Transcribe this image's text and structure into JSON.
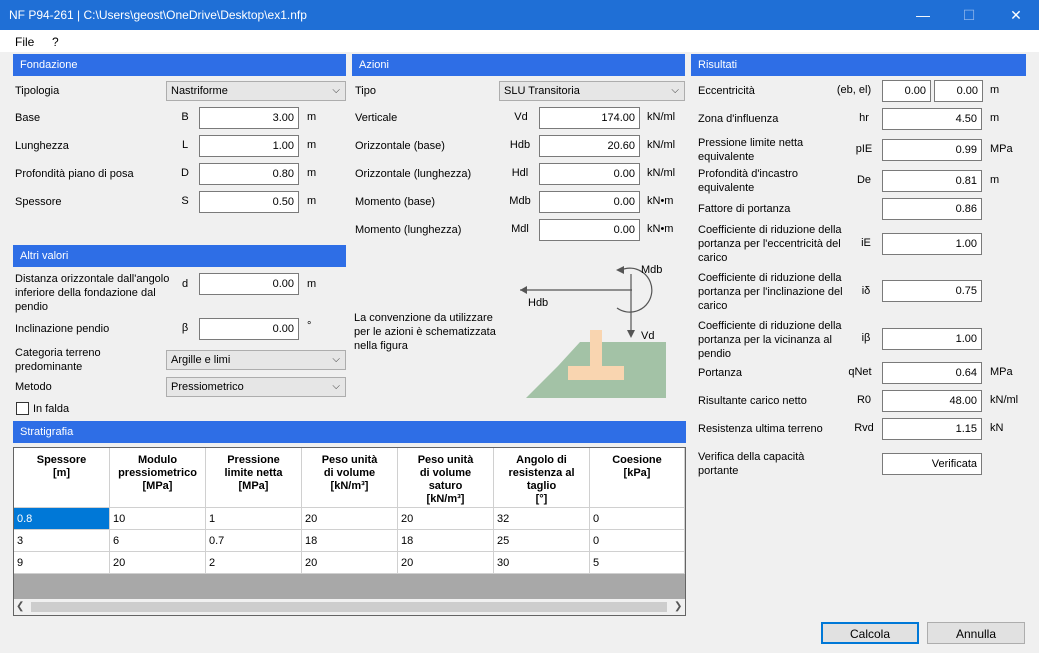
{
  "window": {
    "title": "NF P94-261 | C:\\Users\\geost\\OneDrive\\Desktop\\ex1.nfp",
    "min": "—",
    "max": "☐",
    "close": "✕"
  },
  "menu": [
    "File",
    "?"
  ],
  "fondazione": {
    "title": "Fondazione",
    "tipologia_label": "Tipologia",
    "tipologia_value": "Nastriforme",
    "rows": [
      {
        "label": "Base",
        "sym": "B",
        "value": "3.00",
        "unit": "m"
      },
      {
        "label": "Lunghezza",
        "sym": "L",
        "value": "1.00",
        "unit": "m"
      },
      {
        "label": "Profondità piano di posa",
        "sym": "D",
        "value": "0.80",
        "unit": "m"
      },
      {
        "label": "Spessore",
        "sym": "S",
        "value": "0.50",
        "unit": "m"
      }
    ]
  },
  "altri": {
    "title": "Altri valori",
    "distanza_label": "Distanza orizzontale dall'angolo inferiore della fondazione dal pendio",
    "distanza_sym": "d",
    "distanza_value": "0.00",
    "distanza_unit": "m",
    "incl_label": "Inclinazione pendio",
    "incl_sym": "β",
    "incl_value": "0.00",
    "incl_unit": "°",
    "cat_label": "Categoria terreno predominante",
    "cat_value": "Argille e limi",
    "metodo_label": "Metodo",
    "metodo_value": "Pressiometrico",
    "falda_label": "In falda"
  },
  "azioni": {
    "title": "Azioni",
    "tipo_label": "Tipo",
    "tipo_value": "SLU Transitoria",
    "rows": [
      {
        "label": "Verticale",
        "sym": "Vd",
        "value": "174.00",
        "unit": "kN/ml"
      },
      {
        "label": "Orizzontale (base)",
        "sym": "Hdb",
        "value": "20.60",
        "unit": "kN/ml"
      },
      {
        "label": "Orizzontale (lunghezza)",
        "sym": "Hdl",
        "value": "0.00",
        "unit": "kN/ml"
      },
      {
        "label": "Momento (base)",
        "sym": "Mdb",
        "value": "0.00",
        "unit": "kN•m"
      },
      {
        "label": "Momento (lunghezza)",
        "sym": "Mdl",
        "value": "0.00",
        "unit": "kN•m"
      }
    ],
    "note": "La convenzione da utilizzare per le azioni è schematizzata nella figura",
    "fig_mdb": "Mdb",
    "fig_hdb": "Hdb",
    "fig_vd": "Vd"
  },
  "risultati": {
    "title": "Risultati",
    "ecc_label": "Eccentricità",
    "ecc_sym": "(eb, el)",
    "ecc_v1": "0.00",
    "ecc_v2": "0.00",
    "ecc_unit": "m",
    "rows": [
      {
        "label": "Zona d'influenza",
        "sym": "hr",
        "value": "4.50",
        "unit": "m"
      },
      {
        "label": "Pressione limite netta equivalente",
        "sym": "pIE",
        "value": "0.99",
        "unit": "MPa"
      },
      {
        "label": "Profondità d'incastro equivalente",
        "sym": "De",
        "value": "0.81",
        "unit": "m"
      },
      {
        "label": "Fattore di portanza",
        "sym": "",
        "value": "0.86",
        "unit": ""
      },
      {
        "label": "Coefficiente di riduzione della portanza per l'eccentricità del carico",
        "sym": "iE",
        "value": "1.00",
        "unit": ""
      },
      {
        "label": "Coefficiente di riduzione della portanza per l'inclinazione del carico",
        "sym": "iδ",
        "value": "0.75",
        "unit": ""
      },
      {
        "label": "Coefficiente di riduzione della portanza per la vicinanza al pendio",
        "sym": "iβ",
        "value": "1.00",
        "unit": ""
      },
      {
        "label": "Portanza",
        "sym": "qNet",
        "value": "0.64",
        "unit": "MPa"
      },
      {
        "label": "Risultante carico netto",
        "sym": "R0",
        "value": "48.00",
        "unit": "kN/ml"
      },
      {
        "label": "Resistenza ultima terreno",
        "sym": "Rvd",
        "value": "1.15",
        "unit": "kN"
      }
    ],
    "verifica_label": "Verifica della capacità portante",
    "verifica_value": "Verificata"
  },
  "stratigrafia": {
    "title": "Stratigrafia",
    "headers": [
      [
        "Spessore",
        "[m]"
      ],
      [
        "Modulo",
        "pressiometrico",
        "[MPa]"
      ],
      [
        "Pressione",
        "limite netta",
        "[MPa]"
      ],
      [
        "Peso unità",
        "di volume",
        "[kN/m³]"
      ],
      [
        "Peso unità",
        "di volume",
        "saturo",
        "[kN/m³]"
      ],
      [
        "Angolo di",
        "resistenza al",
        "taglio",
        "[°]"
      ],
      [
        "Coesione",
        "[kPa]"
      ]
    ],
    "rows": [
      [
        "0.8",
        "10",
        "1",
        "20",
        "20",
        "32",
        "0"
      ],
      [
        "3",
        "6",
        "0.7",
        "18",
        "18",
        "25",
        "0"
      ],
      [
        "9",
        "20",
        "2",
        "20",
        "20",
        "30",
        "5"
      ]
    ]
  },
  "buttons": {
    "calcola": "Calcola",
    "annulla": "Annulla"
  }
}
